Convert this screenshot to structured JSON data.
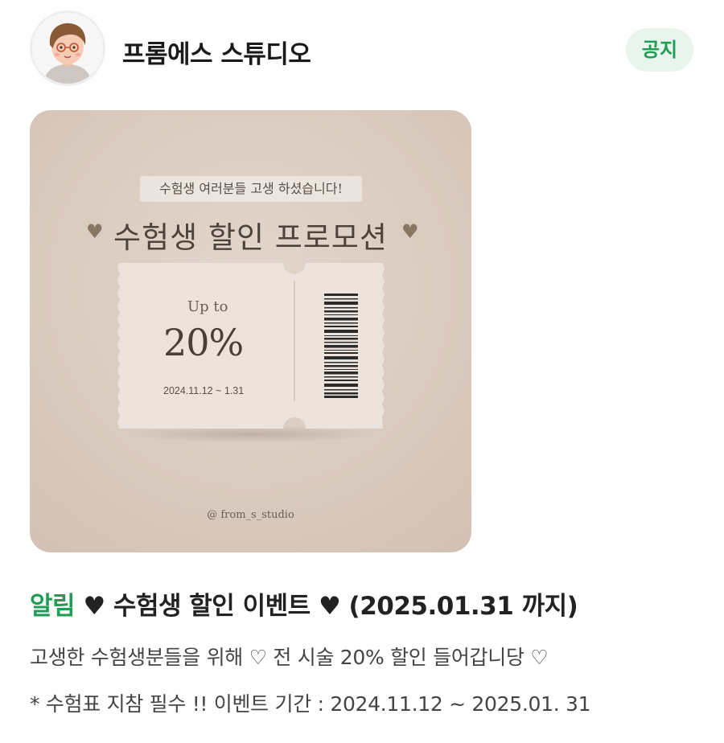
{
  "header": {
    "avatar_icon": "person-avatar-icon",
    "shop_name": "프롬에스 스튜디오",
    "badge_label": "공지",
    "badge_color": "#1f9d55"
  },
  "promo_image": {
    "subtitle": "수험생 여러분들 고생 하셨습니다!",
    "title": "수험생 할인 프로모션",
    "heart_left": "♥",
    "heart_right": "♥",
    "ticket": {
      "up_to": "Up to",
      "discount": "20%",
      "date_range": "2024.11.12 ~ 1.31"
    },
    "handle": "@ from_s_studio",
    "background_color": "#d8c8bc"
  },
  "post": {
    "alert_label": "알림",
    "title_rest": " ♥ 수험생 할인 이벤트 ♥ (2025.01.31 까지)",
    "line1": "고생한 수험생분들을 위해 ♡ 전 시술 20% 할인 들어갑니당 ♡",
    "line2": "* 수험표 지참 필수 !! 이벤트 기간 : 2024.11.12 ~ 2025.01. 31",
    "accent_color": "#1f9d55"
  }
}
